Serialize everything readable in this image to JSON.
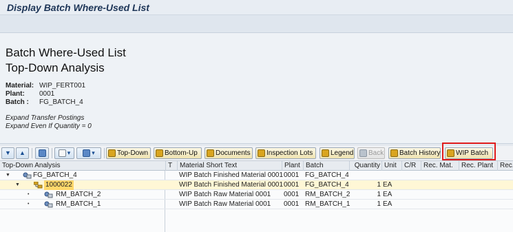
{
  "window": {
    "title": "Display Batch Where-Used List"
  },
  "header": {
    "title_line1": "Batch Where-Used List",
    "title_line2": "Top-Down Analysis",
    "fields": [
      {
        "label": "Material:",
        "value": "WIP_FERT001"
      },
      {
        "label": "Plant:",
        "value": "0001"
      },
      {
        "label": "Batch :",
        "value": "FG_BATCH_4"
      }
    ],
    "notes": [
      "Expand Transfer Postings",
      "Expand Even If Quantity = 0"
    ]
  },
  "splitter": {
    "grip": "....."
  },
  "toolbar": {
    "top_down": "Top-Down",
    "bottom_up": "Bottom-Up",
    "documents": "Documents",
    "inspection_lots": "Inspection Lots",
    "legend": "Legend",
    "back": "Back",
    "batch_history": "Batch History",
    "wip_batch": "WIP Batch"
  },
  "grid": {
    "columns": {
      "tree": "Top-Down Analysis",
      "t": "T",
      "material_short_text": "Material Short Text",
      "plant": "Plant",
      "batch": "Batch",
      "quantity": "Quantity",
      "unit": "Unit",
      "cr": "C/R",
      "rec_mat": "Rec. Mat.",
      "rec_plant": "Rec. Plant",
      "rec": "Rec."
    },
    "rows": [
      {
        "node": "FG_BATCH_4",
        "text": "WIP Batch Finished Material 0001",
        "plant": "0001",
        "batch": "FG_BATCH_4",
        "quantity": "",
        "unit": ""
      },
      {
        "node": "1000022",
        "text": "WIP Batch Finished Material 0001",
        "plant": "0001",
        "batch": "FG_BATCH_4",
        "quantity": "1",
        "unit": "EA"
      },
      {
        "node": "RM_BATCH_2",
        "text": "WIP Batch Raw Material 0001",
        "plant": "0001",
        "batch": "RM_BATCH_2",
        "quantity": "1",
        "unit": "EA"
      },
      {
        "node": "RM_BATCH_1",
        "text": "WIP Batch Raw Material 0001",
        "plant": "0001",
        "batch": "RM_BATCH_1",
        "quantity": "1",
        "unit": "EA"
      }
    ]
  },
  "colors": {
    "highlight": "#e01b1b",
    "selected_row": "#fff7d6"
  }
}
